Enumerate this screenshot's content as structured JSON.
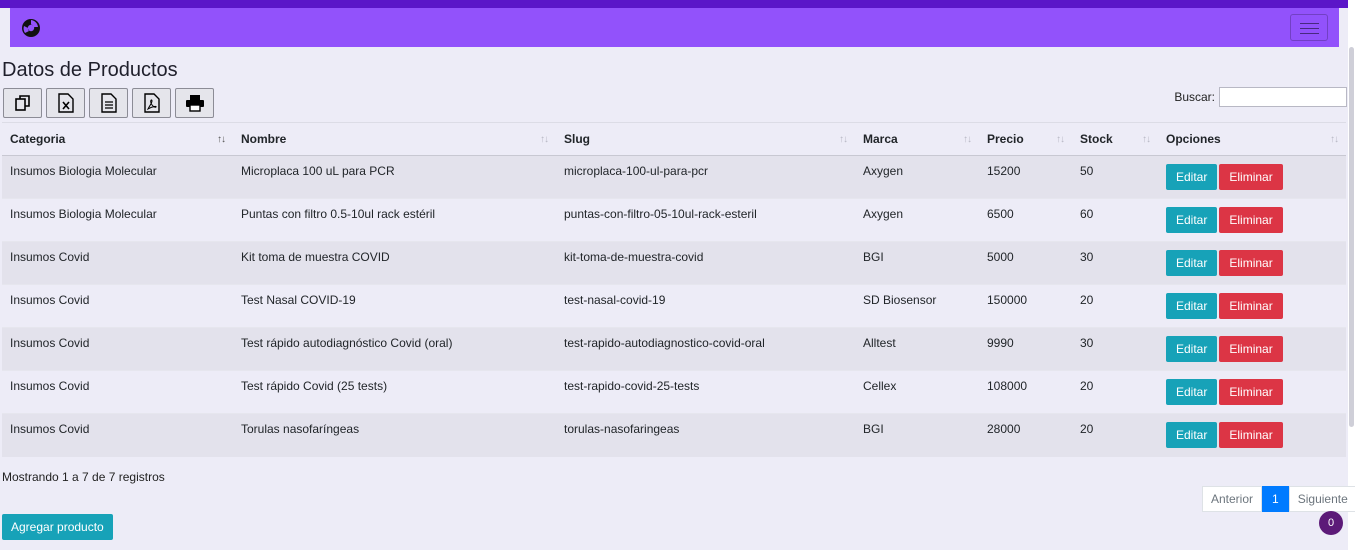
{
  "navbar": {
    "brand_icon": "biohazard-logo-icon",
    "toggler_icon": "hamburger-menu-icon"
  },
  "page": {
    "title": "Datos de Productos"
  },
  "export_buttons": [
    {
      "name": "copy-button",
      "icon": "copy-icon"
    },
    {
      "name": "excel-button",
      "icon": "excel-icon"
    },
    {
      "name": "csv-button",
      "icon": "document-icon"
    },
    {
      "name": "pdf-button",
      "icon": "pdf-icon"
    },
    {
      "name": "print-button",
      "icon": "printer-icon"
    }
  ],
  "search": {
    "label": "Buscar:",
    "value": ""
  },
  "table": {
    "headers": [
      "Categoria",
      "Nombre",
      "Slug",
      "Marca",
      "Precio",
      "Stock",
      "Opciones"
    ],
    "rows": [
      {
        "categoria": "Insumos Biologia Molecular",
        "nombre": "Microplaca 100 uL para PCR",
        "slug": "microplaca-100-ul-para-pcr",
        "marca": "Axygen",
        "precio": "15200",
        "stock": "50"
      },
      {
        "categoria": "Insumos Biologia Molecular",
        "nombre": "Puntas con filtro 0.5-10ul rack estéril",
        "slug": "puntas-con-filtro-05-10ul-rack-esteril",
        "marca": "Axygen",
        "precio": "6500",
        "stock": "60"
      },
      {
        "categoria": "Insumos Covid",
        "nombre": "Kit toma de muestra COVID",
        "slug": "kit-toma-de-muestra-covid",
        "marca": "BGI",
        "precio": "5000",
        "stock": "30"
      },
      {
        "categoria": "Insumos Covid",
        "nombre": "Test Nasal COVID-19",
        "slug": "test-nasal-covid-19",
        "marca": "SD Biosensor",
        "precio": "150000",
        "stock": "20"
      },
      {
        "categoria": "Insumos Covid",
        "nombre": "Test rápido autodiagnóstico Covid (oral)",
        "slug": "test-rapido-autodiagnostico-covid-oral",
        "marca": "Alltest",
        "precio": "9990",
        "stock": "30"
      },
      {
        "categoria": "Insumos Covid",
        "nombre": "Test rápido Covid (25 tests)",
        "slug": "test-rapido-covid-25-tests",
        "marca": "Cellex",
        "precio": "108000",
        "stock": "20"
      },
      {
        "categoria": "Insumos Covid",
        "nombre": "Torulas nasofaríngeas",
        "slug": "torulas-nasofaringeas",
        "marca": "BGI",
        "precio": "28000",
        "stock": "20"
      }
    ],
    "edit_label": "Editar",
    "delete_label": "Eliminar"
  },
  "info": "Mostrando 1 a 7 de 7 registros",
  "pagination": {
    "prev": "Anterior",
    "current": "1",
    "next": "Siguiente"
  },
  "add_button": "Agregar producto",
  "cart_badge": "0",
  "colors": {
    "navbar": "#9252fb",
    "topstrip": "#5b16c8",
    "edit": "#17a2b8",
    "delete": "#dc3545",
    "page_active": "#007bff",
    "badge": "#5c1a78"
  }
}
